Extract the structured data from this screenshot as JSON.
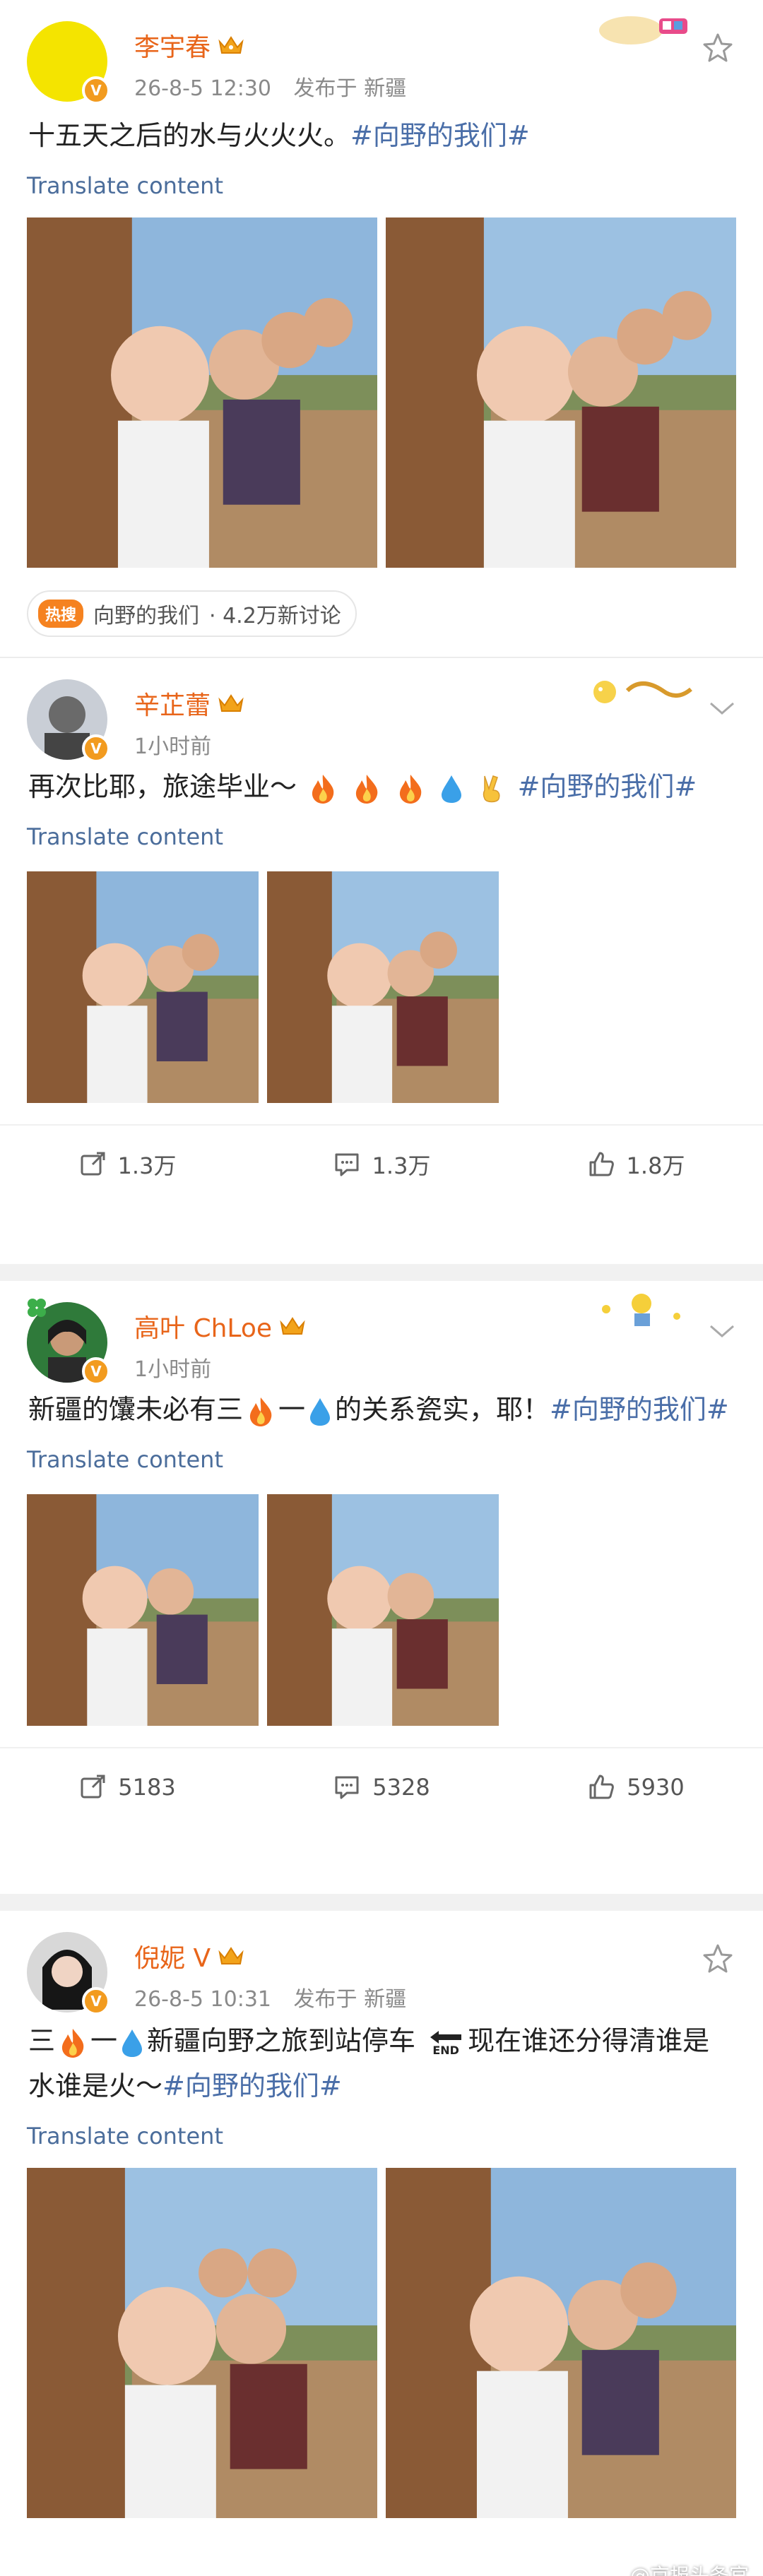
{
  "posts": [
    {
      "author": "李宇春",
      "time": "26-8-5 12:30",
      "location": "发布于 新疆",
      "text": "十五天之后的水与火火火。",
      "hashtag": "#向野的我们#",
      "translate": "Translate content",
      "topic": {
        "badge": "热搜",
        "label": "向野的我们",
        "count": "· 4.2万新讨论"
      }
    },
    {
      "author": "辛芷蕾",
      "time": "1小时前",
      "text_before": "再次比耶，旅途毕业～",
      "hashtag": "#向野的我们#",
      "translate": "Translate content",
      "stats": {
        "reposts": "1.3万",
        "comments": "1.3万",
        "likes": "1.8万"
      }
    },
    {
      "author": "高叶 ChLoe",
      "time": "1小时前",
      "text_a": "新疆的馕未必有三",
      "text_b": "一",
      "text_c": "的关系瓷实，耶！",
      "hashtag": "#向野的我们#",
      "translate": "Translate content",
      "stats": {
        "reposts": "5183",
        "comments": "5328",
        "likes": "5930"
      }
    },
    {
      "author": "倪妮 V",
      "time": "26-8-5 10:31",
      "location": "发布于 新疆",
      "text_a": "三",
      "text_b": "一",
      "text_c": "新疆向野之旅到站停车",
      "end_label": "END",
      "text_d": "现在谁还分得清谁是水谁是火～",
      "hashtag": "#向野的我们#",
      "translate": "Translate content"
    }
  ],
  "watermark": "@京报头条官",
  "colors": {
    "name": "#e8651a",
    "hashtag": "#4a6ea8",
    "translate": "#4b6d9b",
    "meta": "#8a8a8a"
  },
  "icons": [
    "crown-icon",
    "star-icon",
    "chevron-down-icon",
    "repost-icon",
    "comment-icon",
    "like-icon",
    "fire-icon",
    "droplet-icon",
    "victory-hand-icon",
    "end-arrow-icon"
  ]
}
